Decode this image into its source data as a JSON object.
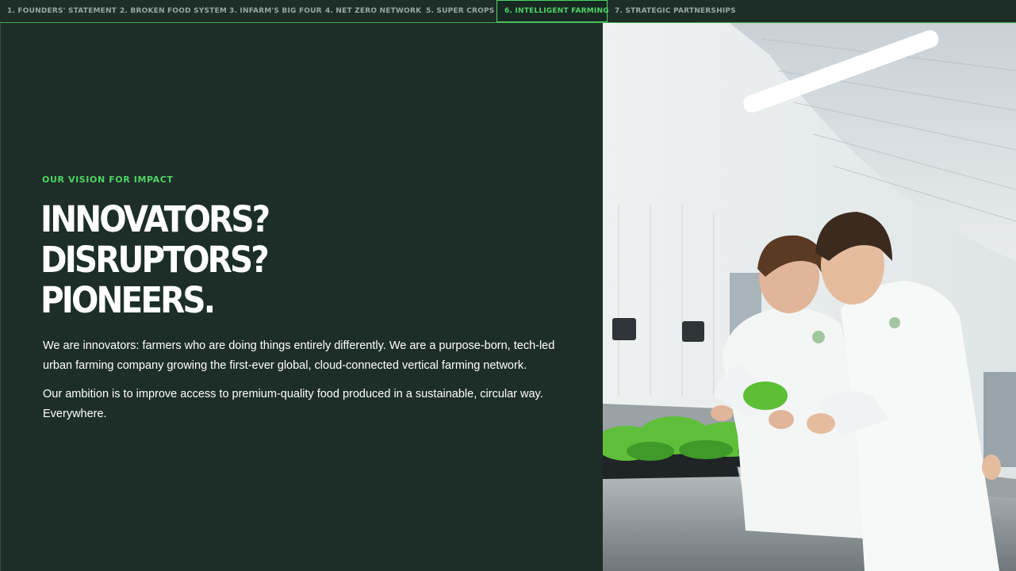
{
  "nav": {
    "tabs": [
      {
        "label": "1. Founders' Statement"
      },
      {
        "label": "2. Broken Food System"
      },
      {
        "label": "3. Infarm's Big Four"
      },
      {
        "label": "4. Net Zero Network"
      },
      {
        "label": "5. Super Crops"
      },
      {
        "label": "6. Intelligent Farming",
        "active": true
      },
      {
        "label": "7. Strategic Partnerships"
      }
    ]
  },
  "main": {
    "eyebrow": "OUR VISION FOR IMPACT",
    "headline": [
      "INNOVATORS?",
      "DISRUPTORS?",
      "PIONEERS."
    ],
    "paragraph1": "We are innovators: farmers who are doing things entirely differently. We are a purpose-born, tech-led urban farming company growing the first-ever global, cloud-connected vertical farming network.",
    "paragraph2": "Our ambition is to improve access to premium-quality food produced in a sustainable, circular way. Everywhere."
  },
  "colors": {
    "background": "#1d2e28",
    "accent": "#4fd462",
    "text": "#ffffff"
  }
}
